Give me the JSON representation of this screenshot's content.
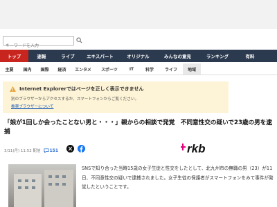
{
  "search": {
    "placeholder": "キーワードを入力"
  },
  "nav_primary": {
    "items": [
      {
        "label": "トップ",
        "active": true
      },
      {
        "label": "速報",
        "active": false
      },
      {
        "label": "ライブ",
        "active": false
      },
      {
        "label": "エキスパート",
        "active": false
      },
      {
        "label": "オリジナル",
        "active": false
      },
      {
        "label": "みんなの意見",
        "active": false
      },
      {
        "label": "ランキング",
        "active": false
      },
      {
        "label": "有料",
        "active": false
      }
    ]
  },
  "nav_secondary": {
    "items": [
      {
        "label": "主要",
        "active": false
      },
      {
        "label": "国内",
        "active": false
      },
      {
        "label": "国際",
        "active": false
      },
      {
        "label": "経済",
        "active": false
      },
      {
        "label": "エンタメ",
        "active": false
      },
      {
        "label": "スポーツ",
        "active": false
      },
      {
        "label": "IT",
        "active": false
      },
      {
        "label": "科学",
        "active": false
      },
      {
        "label": "ライフ",
        "active": false
      },
      {
        "label": "地域",
        "active": true
      }
    ]
  },
  "ie_warning": {
    "title": "Internet Explorerではページを正しく表示できません",
    "body": "別のブラウザーからアクセスするか、スマートフォンからご覧ください。",
    "link": "推奨ブラウザーについて"
  },
  "article": {
    "headline": "「娘が1回しか会ったことない男と・・・」親からの相談で発覚　不同意性交の疑いで23歳の男を逮捕",
    "date": "3/11(月) 11:52 配信",
    "comment_count": "151",
    "source_logo": "rkb",
    "body": "SNSで知り合った当時15歳の女子生徒と性交をしたとして、北九州市の無職の男（23）が11日、不同意性交の疑いで逮捕されました。女子生徒の保護者がスマートフォンをみて事件が発覚したということです。"
  },
  "colors": {
    "nav_primary_bg": "#2b3a4f",
    "nav_active": "#c8251f",
    "warning_bg": "#fdf3d6",
    "link": "#1a5db8",
    "logo_accent": "#e5007f"
  }
}
